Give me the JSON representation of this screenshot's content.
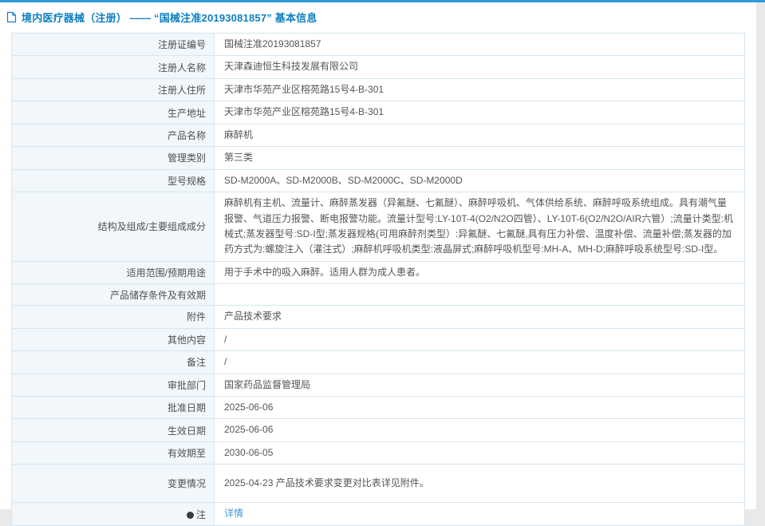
{
  "colors": {
    "accent": "#2e9ad7",
    "title": "#0e7fc1",
    "link": "#4298d5",
    "border": "#d5e5f0",
    "label_bg": "#f1f7fa",
    "text": "#555555"
  },
  "header": {
    "icon": "document-icon",
    "title": "境内医疗器械（注册） —— “国械注准20193081857” 基本信息"
  },
  "table": {
    "rows": [
      {
        "label": "注册证编号",
        "value": "国械注准20193081857"
      },
      {
        "label": "注册人名称",
        "value": "天津森迪恒生科技发展有限公司"
      },
      {
        "label": "注册人住所",
        "value": "天津市华苑产业区榕苑路15号4-B-301"
      },
      {
        "label": "生产地址",
        "value": "天津市华苑产业区榕苑路15号4-B-301"
      },
      {
        "label": "产品名称",
        "value": "麻醉机"
      },
      {
        "label": "管理类别",
        "value": "第三类"
      },
      {
        "label": "型号规格",
        "value": "SD-M2000A、SD-M2000B、SD-M2000C、SD-M2000D"
      },
      {
        "label": "结构及组成/主要组成成分",
        "value": "麻醉机有主机、流量计、麻醉蒸发器（异氟醚、七氟醚）、麻醉呼吸机、气体供给系统、麻醉呼吸系统组成。具有潮气量报警、气道压力报警、断电报警功能。流量计型号:LY-10T-4(O2/N2O四管）、LY-10T-6(O2/N2O/AIR六管）;流量计类型:机械式;蒸发器型号:SD-I型;蒸发器规格(可用麻醉剂类型）:异氟醚、七氟醚,具有压力补偿、温度补偿、流量补偿;蒸发器的加药方式为:螺旋注入（灌注式）;麻醉机呼吸机类型:液晶屏式;麻醉呼吸机型号:MH-A、MH-D;麻醉呼吸系统型号:SD-I型。"
      },
      {
        "label": "适用范围/预期用途",
        "value": "用于手术中的吸入麻醉。适用人群为成人患者。"
      },
      {
        "label": "产品储存条件及有效期",
        "value": ""
      },
      {
        "label": "附件",
        "value": "产品技术要求"
      },
      {
        "label": "其他内容",
        "value": "/"
      },
      {
        "label": "备注",
        "value": "/"
      },
      {
        "label": "审批部门",
        "value": "国家药品监督管理局"
      },
      {
        "label": "批准日期",
        "value": "2025-06-06"
      },
      {
        "label": "生效日期",
        "value": "2025-06-06"
      },
      {
        "label": "有效期至",
        "value": "2030-06-05"
      },
      {
        "label": "变更情况",
        "value": "2025-04-23 产品技术要求变更对比表详见附件。"
      },
      {
        "label": "注",
        "icon": "note-bullet-icon",
        "value": "详情",
        "link": true
      }
    ]
  }
}
